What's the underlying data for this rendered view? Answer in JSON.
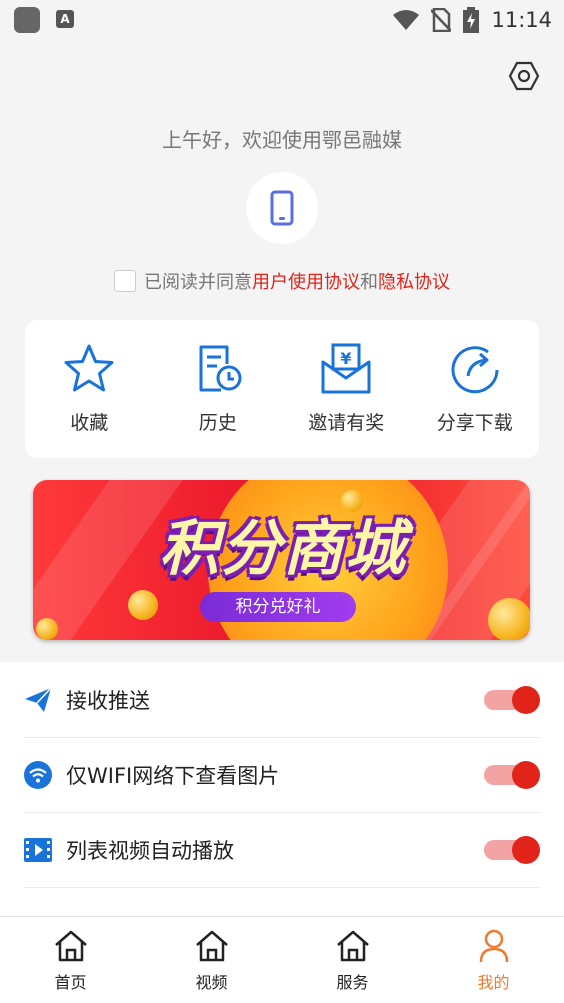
{
  "status_bar": {
    "time": "11:14",
    "a_badge": "A"
  },
  "greeting": "上午好，欢迎使用鄂邑融媒",
  "agreement": {
    "prefix": "已阅读并同意",
    "user_agreement": "用户使用协议",
    "and": "和",
    "privacy": "隐私协议"
  },
  "quick_actions": [
    {
      "label": "收藏",
      "icon": "star-icon"
    },
    {
      "label": "历史",
      "icon": "history-icon"
    },
    {
      "label": "邀请有奖",
      "icon": "invite-reward-icon"
    },
    {
      "label": "分享下载",
      "icon": "share-icon"
    }
  ],
  "banner": {
    "title": "积分商城",
    "subtitle": "积分兑好礼"
  },
  "settings": [
    {
      "label": "接收推送",
      "icon": "send-icon",
      "enabled": true
    },
    {
      "label": "仅WIFI网络下查看图片",
      "icon": "wifi-icon",
      "enabled": true
    },
    {
      "label": "列表视频自动播放",
      "icon": "video-icon",
      "enabled": true
    }
  ],
  "tabs": [
    {
      "label": "首页",
      "icon": "home-icon",
      "active": false
    },
    {
      "label": "视频",
      "icon": "home-icon",
      "active": false
    },
    {
      "label": "服务",
      "icon": "home-icon",
      "active": false
    },
    {
      "label": "我的",
      "icon": "person-icon",
      "active": true
    }
  ],
  "colors": {
    "accent_red": "#e2231a",
    "icon_blue": "#1a73d9",
    "tab_active": "#f07b30"
  }
}
